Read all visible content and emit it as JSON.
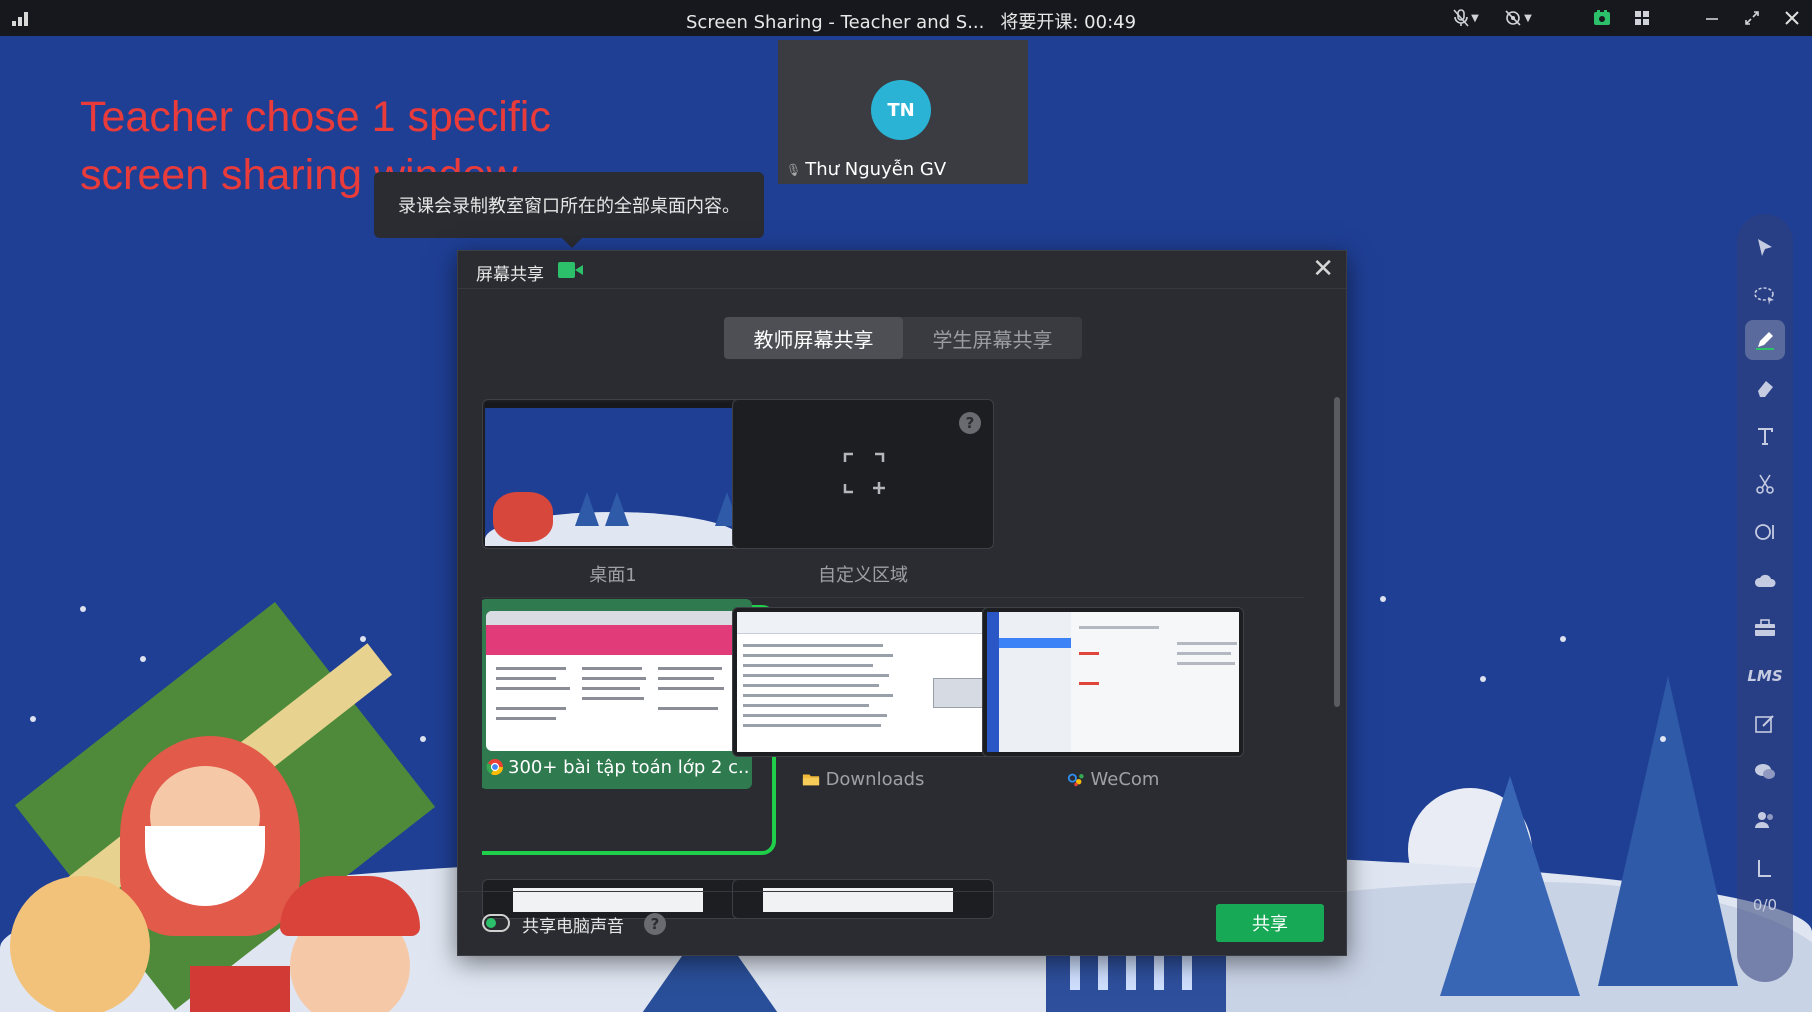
{
  "titlebar": {
    "title": "Screen Sharing - Teacher and S...",
    "countdown": "将要开课: 00:49"
  },
  "annotation": {
    "line1": "Teacher chose 1 specific",
    "line2": "screen sharing window"
  },
  "video": {
    "initials": "TN",
    "name": "Thư Nguyễn GV"
  },
  "tooltip": {
    "text": "录课会录制教室窗口所在的全部桌面内容。"
  },
  "modal": {
    "title": "屏幕共享",
    "tabs": [
      {
        "label": "教师屏幕共享",
        "active": true
      },
      {
        "label": "学生屏幕共享",
        "active": false
      }
    ],
    "cards": [
      {
        "label": "桌面1"
      },
      {
        "label": "自定义区域"
      },
      {
        "label": "300+ bài tập toán lớp 2 c..."
      },
      {
        "label": "Downloads"
      },
      {
        "label": "WeCom"
      }
    ],
    "footer": {
      "audio_label": "共享电脑声音",
      "help": "?",
      "share_label": "共享"
    }
  },
  "toolbar": {
    "lms_label": "LMS",
    "counter": "0/0"
  },
  "colors": {
    "accent_green": "#18a957",
    "selection_green": "#1fcf4a",
    "annotation_red": "#ea3b3b",
    "background_blue": "#1f3f95"
  }
}
